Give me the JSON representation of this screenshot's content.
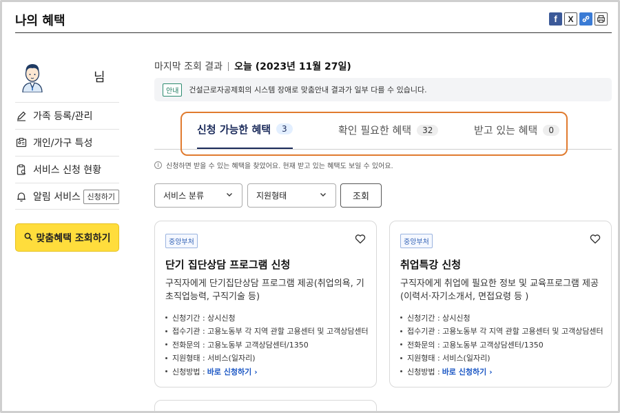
{
  "header": {
    "title": "나의 혜택",
    "share": {
      "facebook": "f",
      "x": "X",
      "link": "link",
      "print": "print"
    }
  },
  "sidebar": {
    "user_suffix": "님",
    "menu": [
      {
        "label": "가족 등록/관리",
        "icon": "pencil-icon"
      },
      {
        "label": "개인/가구 특성",
        "icon": "id-card-icon"
      },
      {
        "label": "서비스 신청 현황",
        "icon": "clipboard-icon"
      },
      {
        "label": "알림 서비스",
        "icon": "bell-icon",
        "button": "신청하기"
      }
    ],
    "cta_label": "맞춤혜택 조회하기"
  },
  "main": {
    "last_query_label": "마지막 조회 결과",
    "last_query_value": "오늘 (2023년 11월 27일)",
    "notice_tag": "안내",
    "notice_text": "건설근로자공제회의 시스템 장애로 맞춤안내 결과가 일부 다를 수 있습니다.",
    "tabs": [
      {
        "label": "신청 가능한 혜택",
        "count": "3",
        "active": true
      },
      {
        "label": "확인 필요한 혜택",
        "count": "32",
        "active": false
      },
      {
        "label": "받고 있는 혜택",
        "count": "0",
        "active": false
      }
    ],
    "hint": "신청하면 받을 수 있는 혜택을 찾았어요. 현재 받고 있는 혜택도 보일 수 있어요.",
    "filters": {
      "category": "서비스 분류",
      "support_type": "지원형태",
      "search_label": "조회"
    },
    "cards": [
      {
        "tag": "중앙부처",
        "title": "단기 집단상담 프로그램 신청",
        "desc": "구직자에게 단기집단상담 프로그램 제공(취업의욕, 기초직업능력, 구직기술 등)",
        "info": [
          "신청기간 : 상시신청",
          "접수기관 : 고용노동부 각 지역 관할 고용센터 및 고객상담센터",
          "전화문의 : 고용노동부 고객상담센터/1350",
          "지원형태 : 서비스(일자리)"
        ],
        "method_label": "신청방법 :",
        "method_link": "바로 신청하기"
      },
      {
        "tag": "중앙부처",
        "title": "취업특강 신청",
        "desc": "구직자에게 취업에 필요한 정보 및 교육프로그램 제공(이력서·자기소개서, 면접요령 등 )",
        "info": [
          "신청기간 : 상시신청",
          "접수기관 : 고용노동부 각 지역 관할 고용센터 및 고객상담센터",
          "전화문의 : 고용노동부 고객상담센터/1350",
          "지원형태 : 서비스(일자리)"
        ],
        "method_label": "신청방법 :",
        "method_link": "바로 신청하기"
      }
    ]
  }
}
